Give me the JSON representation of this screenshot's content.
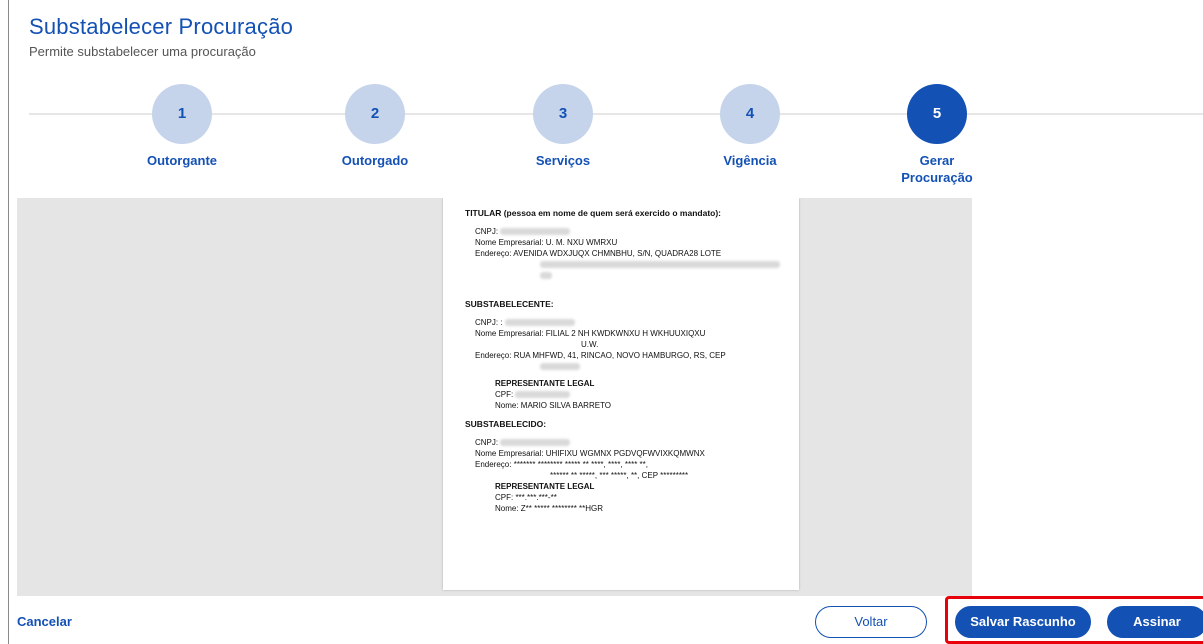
{
  "header": {
    "title": "Substabelecer Procuração",
    "subtitle": "Permite substabelecer uma procuração"
  },
  "stepper": {
    "steps": [
      {
        "number": "1",
        "label": "Outorgante"
      },
      {
        "number": "2",
        "label": "Outorgado"
      },
      {
        "number": "3",
        "label": "Serviços"
      },
      {
        "number": "4",
        "label": "Vigência"
      },
      {
        "number": "5",
        "label": "Gerar Procuração"
      }
    ],
    "active_step": 5
  },
  "document": {
    "titular": {
      "title": "TITULAR (pessoa em nome de quem será exercido o mandato):",
      "cnpj_label": "CNPJ:",
      "nome_label": "Nome Empresarial:",
      "nome_value": "U. M. NXU WMRXU",
      "endereco_label": "Endereço:",
      "endereco_value": "AVENIDA WDXJUQX CHMNBHU, S/N, QUADRA28 LOTE"
    },
    "substabelecente": {
      "title": "SUBSTABELECENTE:",
      "cnpj_label": "CNPJ: :",
      "nome_label": "Nome Empresarial:",
      "nome_value": "FILIAL 2 NH KWDKWNXU H WKHUUXIQXU",
      "nome_value_2": "U.W.",
      "endereco_label": "Endereço:",
      "endereco_value": "RUA MHFWD, 41, RINCAO, NOVO HAMBURGO, RS, CEP",
      "rep_title": "REPRESENTANTE LEGAL",
      "rep_cpf_label": "CPF:",
      "rep_nome": "Nome: MARIO SILVA BARRETO"
    },
    "substabelecido": {
      "title": "SUBSTABELECIDO:",
      "cnpj_label": "CNPJ:",
      "nome_label": "Nome Empresarial:",
      "nome_value": "UHIFIXU WGMNX PGDVQFWVIXKQMWNX",
      "endereco_label": "Endereço:",
      "endereco_value": "******* ******** ***** ** ****, ****, **** **,",
      "endereco_value_2": "****** ** *****, *** *****, **, CEP *********",
      "rep_title": "REPRESENTANTE LEGAL",
      "rep_cpf": "CPF: ***.***.***-**",
      "rep_nome": "Nome: Z** ***** ******** **HGR"
    }
  },
  "footer": {
    "cancel_label": "Cancelar",
    "back_label": "Voltar",
    "save_draft_label": "Salvar Rascunho",
    "sign_label": "Assinar"
  },
  "colors": {
    "primary": "#1351b4",
    "step_inactive": "#c5d4eb",
    "highlight": "#e8000b"
  }
}
